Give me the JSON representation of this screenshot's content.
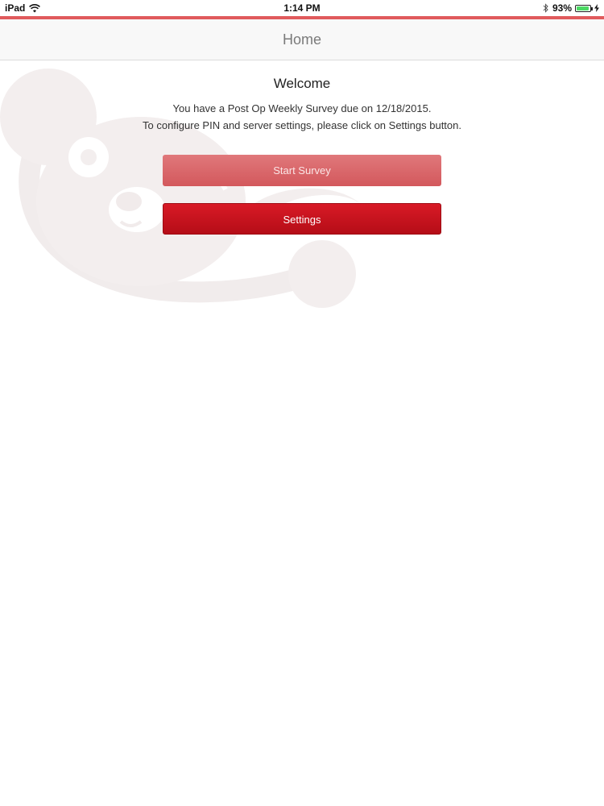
{
  "status_bar": {
    "device": "iPad",
    "time": "1:14 PM",
    "battery": "93%",
    "battery_level": 0.93
  },
  "nav": {
    "title": "Home"
  },
  "main": {
    "welcome_title": "Welcome",
    "message_line1": "You have a Post Op Weekly Survey due on 12/18/2015.",
    "message_line2": "To configure PIN and server settings, please click on Settings button.",
    "start_survey_label": "Start Survey",
    "settings_label": "Settings"
  },
  "colors": {
    "accent": "#e05a5c",
    "primary_button": "#c8101c",
    "disabled_button": "#d9686b"
  }
}
